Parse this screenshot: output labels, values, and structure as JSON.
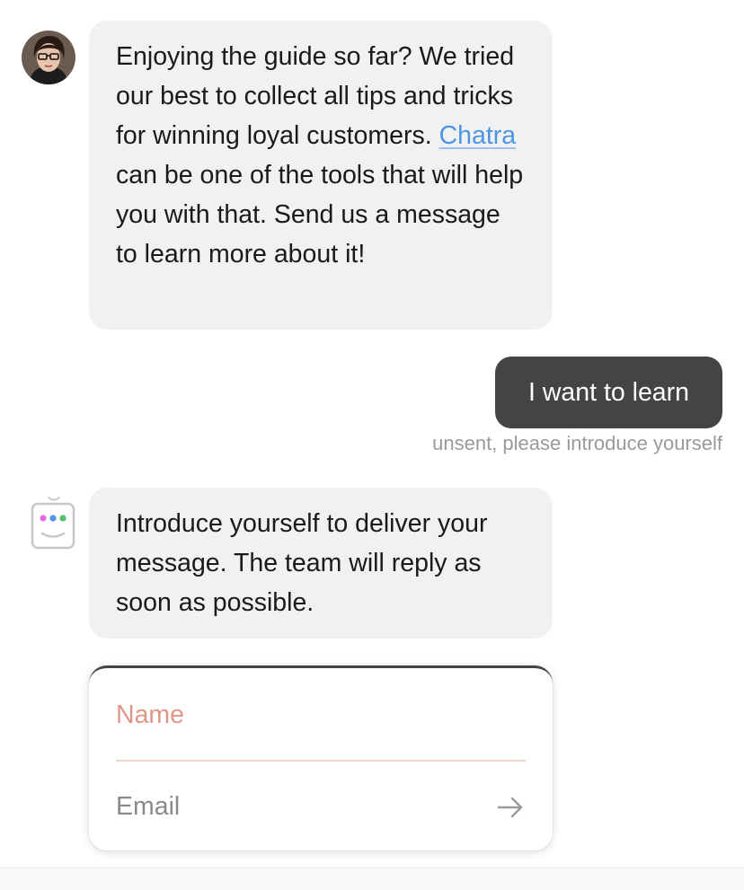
{
  "messages": {
    "agent_intro": {
      "text_before_link": "Enjoying the guide so far? We tried our best to collect all tips and tricks for winning loyal customers. ",
      "link_text": "Chatra",
      "text_after_link": " can be one of the tools that will help you with that. Send us a message to learn more about it!"
    },
    "visitor_message": {
      "text": "I want to learn",
      "status": "unsent, please introduce yourself"
    },
    "bot_prompt": {
      "text": "Introduce yourself to deliver your message. The team will reply as soon as possible."
    }
  },
  "intro_form": {
    "name_placeholder": "Name",
    "email_placeholder": "Email"
  },
  "icons": {
    "agent_avatar": "agent-avatar",
    "bot": "chatra-bot-icon",
    "submit": "arrow-right-icon"
  },
  "colors": {
    "bubble_bg": "#f0f1f3",
    "sent_bubble_bg": "#444444",
    "link": "#4f94e0",
    "name_placeholder": "#e0978a",
    "bot_dots": [
      "#e86be0",
      "#4f94e0",
      "#55c06a"
    ]
  }
}
